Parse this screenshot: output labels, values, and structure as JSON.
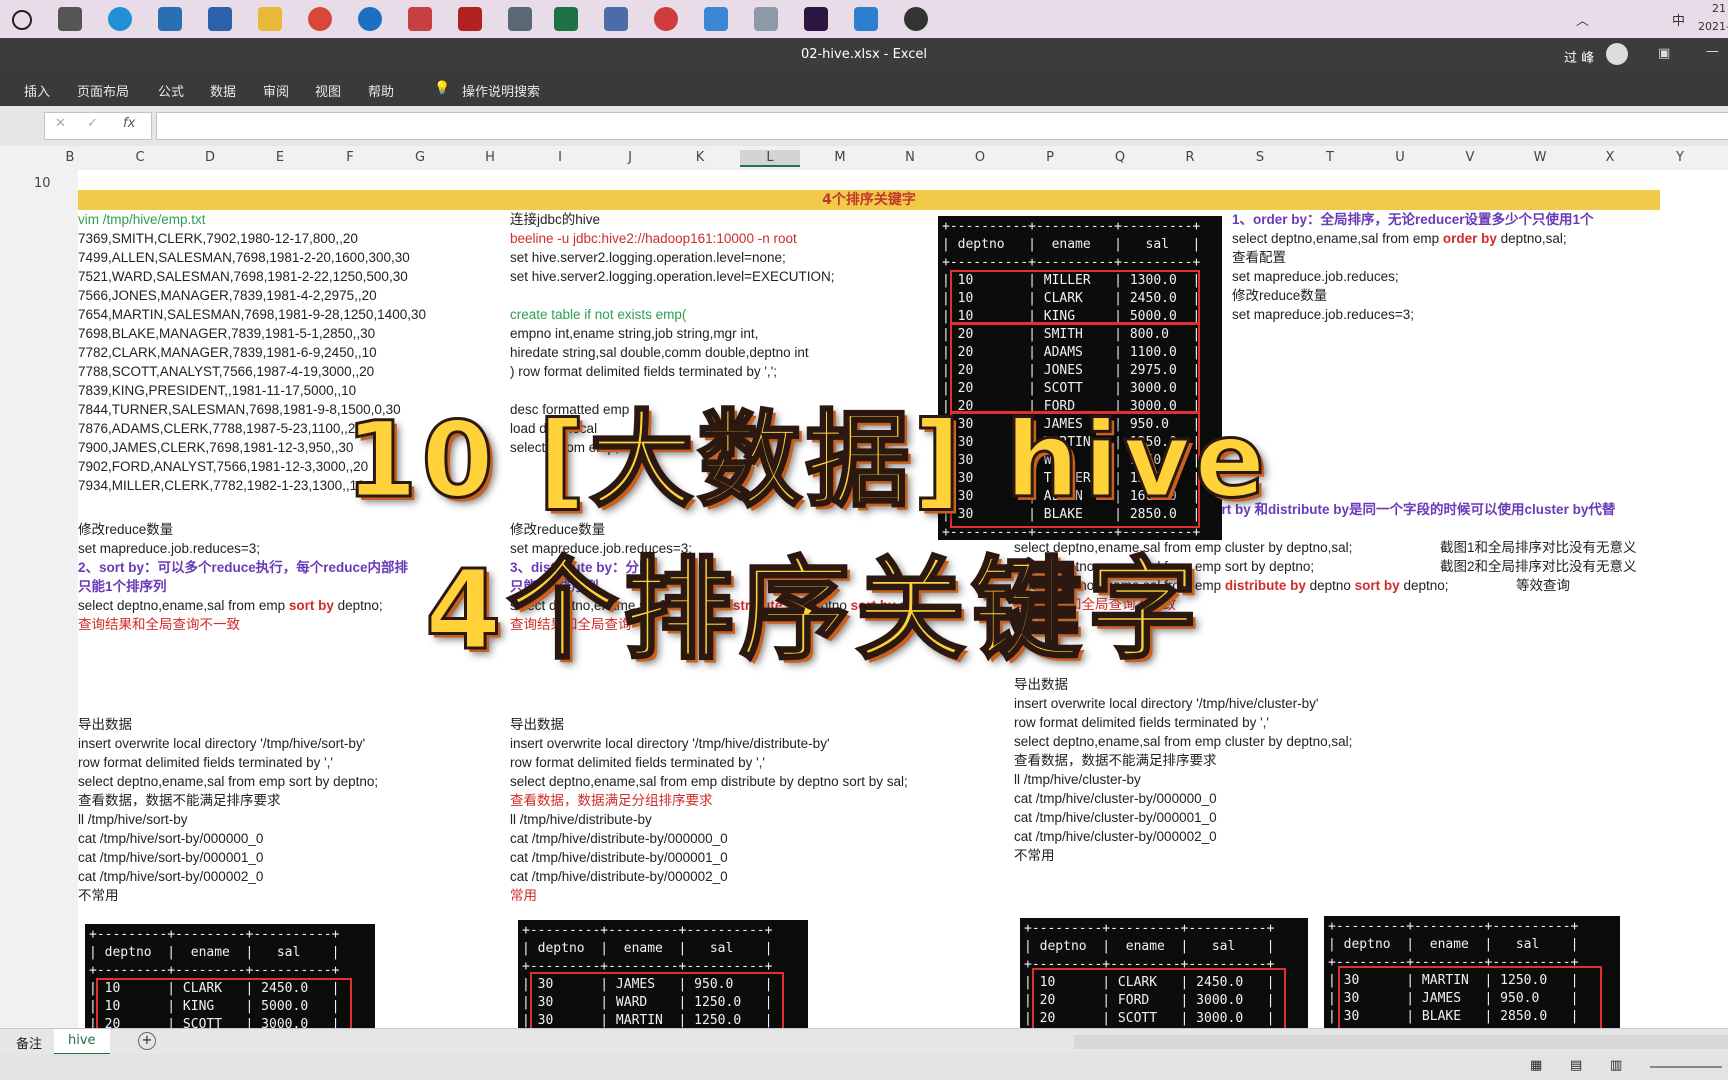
{
  "taskbar": {
    "clock": "21",
    "clock2": "2021-",
    "ime": "中"
  },
  "window": {
    "title": "02-hive.xlsx  -  Excel",
    "user": "过 峰"
  },
  "ribbon": {
    "tabs": [
      "插入",
      "页面布局",
      "公式",
      "数据",
      "审阅",
      "视图",
      "帮助"
    ],
    "search": "操作说明搜索"
  },
  "formula": {
    "fx": "fx"
  },
  "columns": [
    "B",
    "C",
    "D",
    "E",
    "F",
    "G",
    "H",
    "I",
    "J",
    "K",
    "L",
    "M",
    "N",
    "O",
    "P",
    "Q",
    "R",
    "S",
    "T",
    "U",
    "V",
    "W",
    "X",
    "Y"
  ],
  "rows": {
    "r10": "10"
  },
  "banner": "4个排序关键字",
  "colA": {
    "lines": [
      "vim /tmp/hive/emp.txt",
      "7369,SMITH,CLERK,7902,1980-12-17,800,,20",
      "7499,ALLEN,SALESMAN,7698,1981-2-20,1600,300,30",
      "7521,WARD,SALESMAN,7698,1981-2-22,1250,500,30",
      "7566,JONES,MANAGER,7839,1981-4-2,2975,,20",
      "7654,MARTIN,SALESMAN,7698,1981-9-28,1250,1400,30",
      "7698,BLAKE,MANAGER,7839,1981-5-1,2850,,30",
      "7782,CLARK,MANAGER,7839,1981-6-9,2450,,10",
      "7788,SCOTT,ANALYST,7566,1987-4-19,3000,,20",
      "7839,KING,PRESIDENT,,1981-11-17,5000,,10",
      "7844,TURNER,SALESMAN,7698,1981-9-8,1500,0,30",
      "7876,ADAMS,CLERK,7788,1987-5-23,1100,,20",
      "7900,JAMES,CLERK,7698,1981-12-3,950,,30",
      "7902,FORD,ANALYST,7566,1981-12-3,3000,,20",
      "7934,MILLER,CLERK,7782,1982-1-23,1300,,10"
    ],
    "reduce_title": "修改reduce数量",
    "reduce_set": "set mapreduce.job.reduces=3;",
    "sort_title": "2、sort by：可以多个reduce执行，每个reduce内部排",
    "sort_sub": "只能1个排序列",
    "sort_q1": "select deptno,ename,sal from emp ",
    "sort_kw": "sort by",
    "sort_q2": " deptno;",
    "sort_note": "查询结果和全局查询不一致",
    "export": [
      "导出数据",
      "insert overwrite local directory '/tmp/hive/sort-by'",
      "row format delimited fields terminated by ','",
      "select deptno,ename,sal from emp sort by deptno;",
      "查看数据，数据不能满足排序要求",
      "ll /tmp/hive/sort-by",
      "cat /tmp/hive/sort-by/000000_0",
      "cat /tmp/hive/sort-by/000001_0",
      "cat /tmp/hive/sort-by/000002_0",
      "不常用"
    ]
  },
  "colB": {
    "lines": [
      "连接jdbc的hive",
      "beeline -u jdbc:hive2://hadoop161:10000 -n root",
      "set hive.server2.logging.operation.level=none;",
      "set hive.server2.logging.operation.level=EXECUTION;",
      "",
      "create table if not exists emp(",
      "empno int,ename string,job string,mgr int,",
      "hiredate string,sal double,comm double,deptno int",
      ") row format delimited fields terminated by ',';",
      "",
      "desc formatted emp",
      "load data local",
      "select * from emp;"
    ],
    "reduce_title": "修改reduce数量",
    "reduce_set": "set mapreduce.job.reduces=3;",
    "dist_title": "3、distribute by：分区，",
    "dist_sub": "只能1个排序列",
    "dist_q1": "select deptno,ename,sal from emp ",
    "dist_kw": "distribute by",
    "dist_q2": " deptno ",
    "dist_kw2": "sort by",
    "dist_q3": " sal;",
    "dist_note": "查询结果和全局查询一致",
    "export": [
      "导出数据",
      "insert overwrite local directory '/tmp/hive/distribute-by'",
      "row format delimited fields terminated by ','",
      "select deptno,ename,sal from emp distribute by deptno sort by sal;",
      "查看数据，数据满足分组排序要求",
      "ll /tmp/hive/distribute-by",
      "cat /tmp/hive/distribute-by/000000_0",
      "cat /tmp/hive/distribute-by/000001_0",
      "cat /tmp/hive/distribute-by/000002_0",
      "常用"
    ]
  },
  "colC": {
    "order_title": "1、order by：全局排序，无论reducer设置多少个只使用1个",
    "order_q1": "select deptno,ename,sal from emp ",
    "order_kw": "order by",
    "order_q2": " deptno,sal;",
    "lines": [
      "查看配置",
      "set mapreduce.job.reduces;",
      "修改reduce数量",
      "set mapreduce.job.reduces=3;"
    ],
    "cluster_title": "4、cluster by：当sort by 和distribute by是同一个字段的时候可以使用cluster by代替",
    "cluster_sub": "，但无意",
    "cluster_q1": "select deptno,ename,sal from emp cluster by deptno,sal;",
    "cluster_q2": "select deptno,ename,sal from emp sort by deptno;",
    "cluster_q3a": "select deptno,ename,sal from emp ",
    "cluster_q3kw": "distribute by",
    "cluster_q3b": " deptno ",
    "cluster_q3kw2": "sort by",
    "cluster_q3c": " deptno;",
    "cluster_note": "查询结果和全局查询不一致",
    "side1": "截图1和全局排序对比没有无意义",
    "side2": "截图2和全局排序对比没有无意义",
    "side3": "等效查询",
    "export": [
      "导出数据",
      "insert overwrite local directory '/tmp/hive/cluster-by'",
      "row format delimited fields terminated by ','",
      "select deptno,ename,sal from emp cluster by deptno,sal;",
      "查看数据，数据不能满足排序要求",
      "ll /tmp/hive/cluster-by",
      "cat /tmp/hive/cluster-by/000000_0",
      "cat /tmp/hive/cluster-by/000001_0",
      "cat /tmp/hive/cluster-by/000002_0",
      "不常用"
    ]
  },
  "terminals": {
    "main": "+----------+----------+---------+\n| deptno   |  ename   |   sal   |\n+----------+----------+---------+\n| 10       | MILLER   | 1300.0  |\n| 10       | CLARK    | 2450.0  |\n| 10       | KING     | 5000.0  |\n| 20       | SMITH    | 800.0   |\n| 20       | ADAMS    | 1100.0  |\n| 20       | JONES    | 2975.0  |\n| 20       | SCOTT    | 3000.0  |\n| 20       | FORD     | 3000.0  |\n| 30       | JAMES    | 950.0   |\n| 30       | MARTIN   | 1250.0  |\n| 30       | WARD     | 1250.0  |\n| 30       | TURNER   | 1500.0  |\n| 30       | ALLEN    | 1600.0  |\n| 30       | BLAKE    | 2850.0  |\n+----------+----------+---------+",
    "sort": "+---------+---------+----------+\n| deptno  |  ename  |   sal    |\n+---------+---------+----------+\n| 10      | CLARK   | 2450.0   |\n| 10      | KING    | 5000.0   |\n| 20      | SCOTT   | 3000.0   |",
    "dist": "+---------+---------+----------+\n| deptno  |  ename  |   sal    |\n+---------+---------+----------+\n| 30      | JAMES   | 950.0    |\n| 30      | WARD    | 1250.0   |\n| 30      | MARTIN  | 1250.0   |",
    "cluster1": "+---------+---------+----------+\n| deptno  |  ename  |   sal    |\n+---------+---------+----------+\n| 10      | CLARK   | 2450.0   |\n| 20      | FORD    | 3000.0   |\n| 20      | SCOTT   | 3000.0   |",
    "cluster2": "+---------+---------+----------+\n| deptno  |  ename  |   sal    |\n+---------+---------+----------+\n| 30      | MARTIN  | 1250.0   |\n| 30      | JAMES   | 950.0    |\n| 30      | BLAKE   | 2850.0   |"
  },
  "overlay": {
    "line1": "10 [大数据] hive",
    "line2": "4个排序关键字"
  },
  "tabs": {
    "notes": "备注",
    "hive": "hive"
  }
}
